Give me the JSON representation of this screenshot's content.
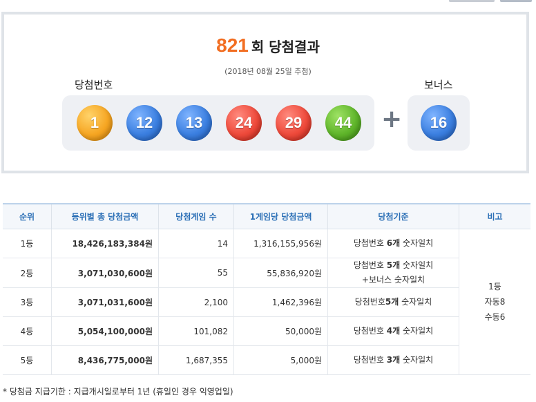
{
  "draw": {
    "round": "821",
    "round_suffix": "회 당첨결과",
    "date": "(2018년 08월 25일 추첨)",
    "winning_label": "당첨번호",
    "bonus_label": "보너스",
    "plus": "+",
    "numbers": [
      "1",
      "12",
      "13",
      "24",
      "29",
      "44"
    ],
    "bonus": "16",
    "ball_colors": {
      "1-10": "#f6a623",
      "11-20": "#3b7fe0",
      "21-30": "#ee4a3b",
      "41-45": "#5fb52a"
    }
  },
  "table": {
    "headers": [
      "순위",
      "등위별 총 당첨금액",
      "당첨게임 수",
      "1게임당 당첨금액",
      "당첨기준",
      "비고"
    ],
    "rows": [
      {
        "rank": "1등",
        "total": "18,426,183,384원",
        "count": "14",
        "per_game": "1,316,155,956원",
        "criteria": [
          "당첨번호 ",
          "6개",
          " 숫자일치"
        ]
      },
      {
        "rank": "2등",
        "total": "3,071,030,600원",
        "count": "55",
        "per_game": "55,836,920원",
        "criteria": [
          "당첨번호 ",
          "5개",
          " 숫자일치"
        ],
        "criteria2": "+보너스 숫자일치"
      },
      {
        "rank": "3등",
        "total": "3,071,031,600원",
        "count": "2,100",
        "per_game": "1,462,396원",
        "criteria": [
          "당첨번호",
          "5개",
          " 숫자일치"
        ]
      },
      {
        "rank": "4등",
        "total": "5,054,100,000원",
        "count": "101,082",
        "per_game": "50,000원",
        "criteria": [
          "당첨번호 ",
          "4개",
          " 숫자일치"
        ]
      },
      {
        "rank": "5등",
        "total": "8,436,775,000원",
        "count": "1,687,355",
        "per_game": "5,000원",
        "criteria": [
          "당첨번호 ",
          "3개",
          " 숫자일치"
        ]
      }
    ],
    "note": [
      "1등",
      "자동8",
      "수동6"
    ]
  },
  "footnote": "* 당첨금 지급기한 : 지급개시일로부터 1년 (휴일인 경우 익영업일)"
}
